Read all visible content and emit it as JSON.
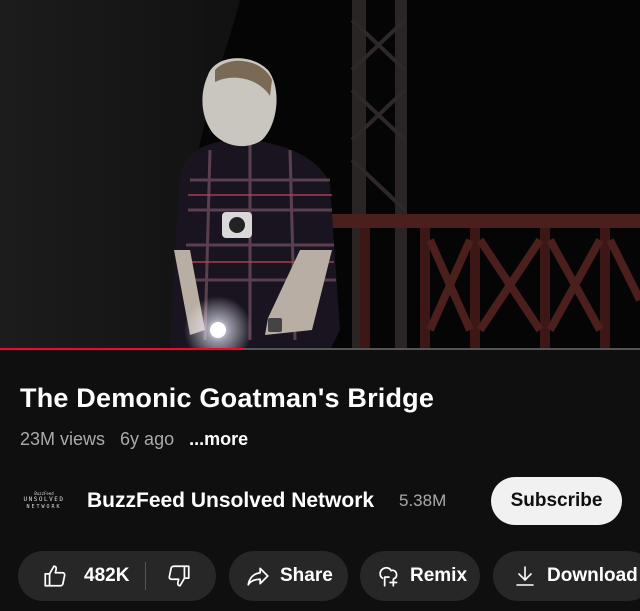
{
  "video": {
    "title": "The Demonic Goatman's Bridge",
    "progress_fraction": 0.38
  },
  "meta": {
    "views": "23M views",
    "age": "6y ago",
    "more": "...more"
  },
  "channel": {
    "logo_line1": "BuzzFeed",
    "logo_line2": "UNSOLVED",
    "logo_line3": "NETWORK",
    "name": "BuzzFeed Unsolved Network",
    "subscribers": "5.38M",
    "subscribe_label": "Subscribe"
  },
  "actions": {
    "like_count": "482K",
    "share_label": "Share",
    "remix_label": "Remix",
    "download_label": "Download"
  },
  "icons": [
    "thumbs-up-icon",
    "thumbs-down-icon",
    "share-icon",
    "remix-icon",
    "download-icon"
  ],
  "colors": {
    "background": "#0f0f0f",
    "progress": "#ff0033",
    "pill": "#272727",
    "subscribe_bg": "#f1f1f1"
  }
}
